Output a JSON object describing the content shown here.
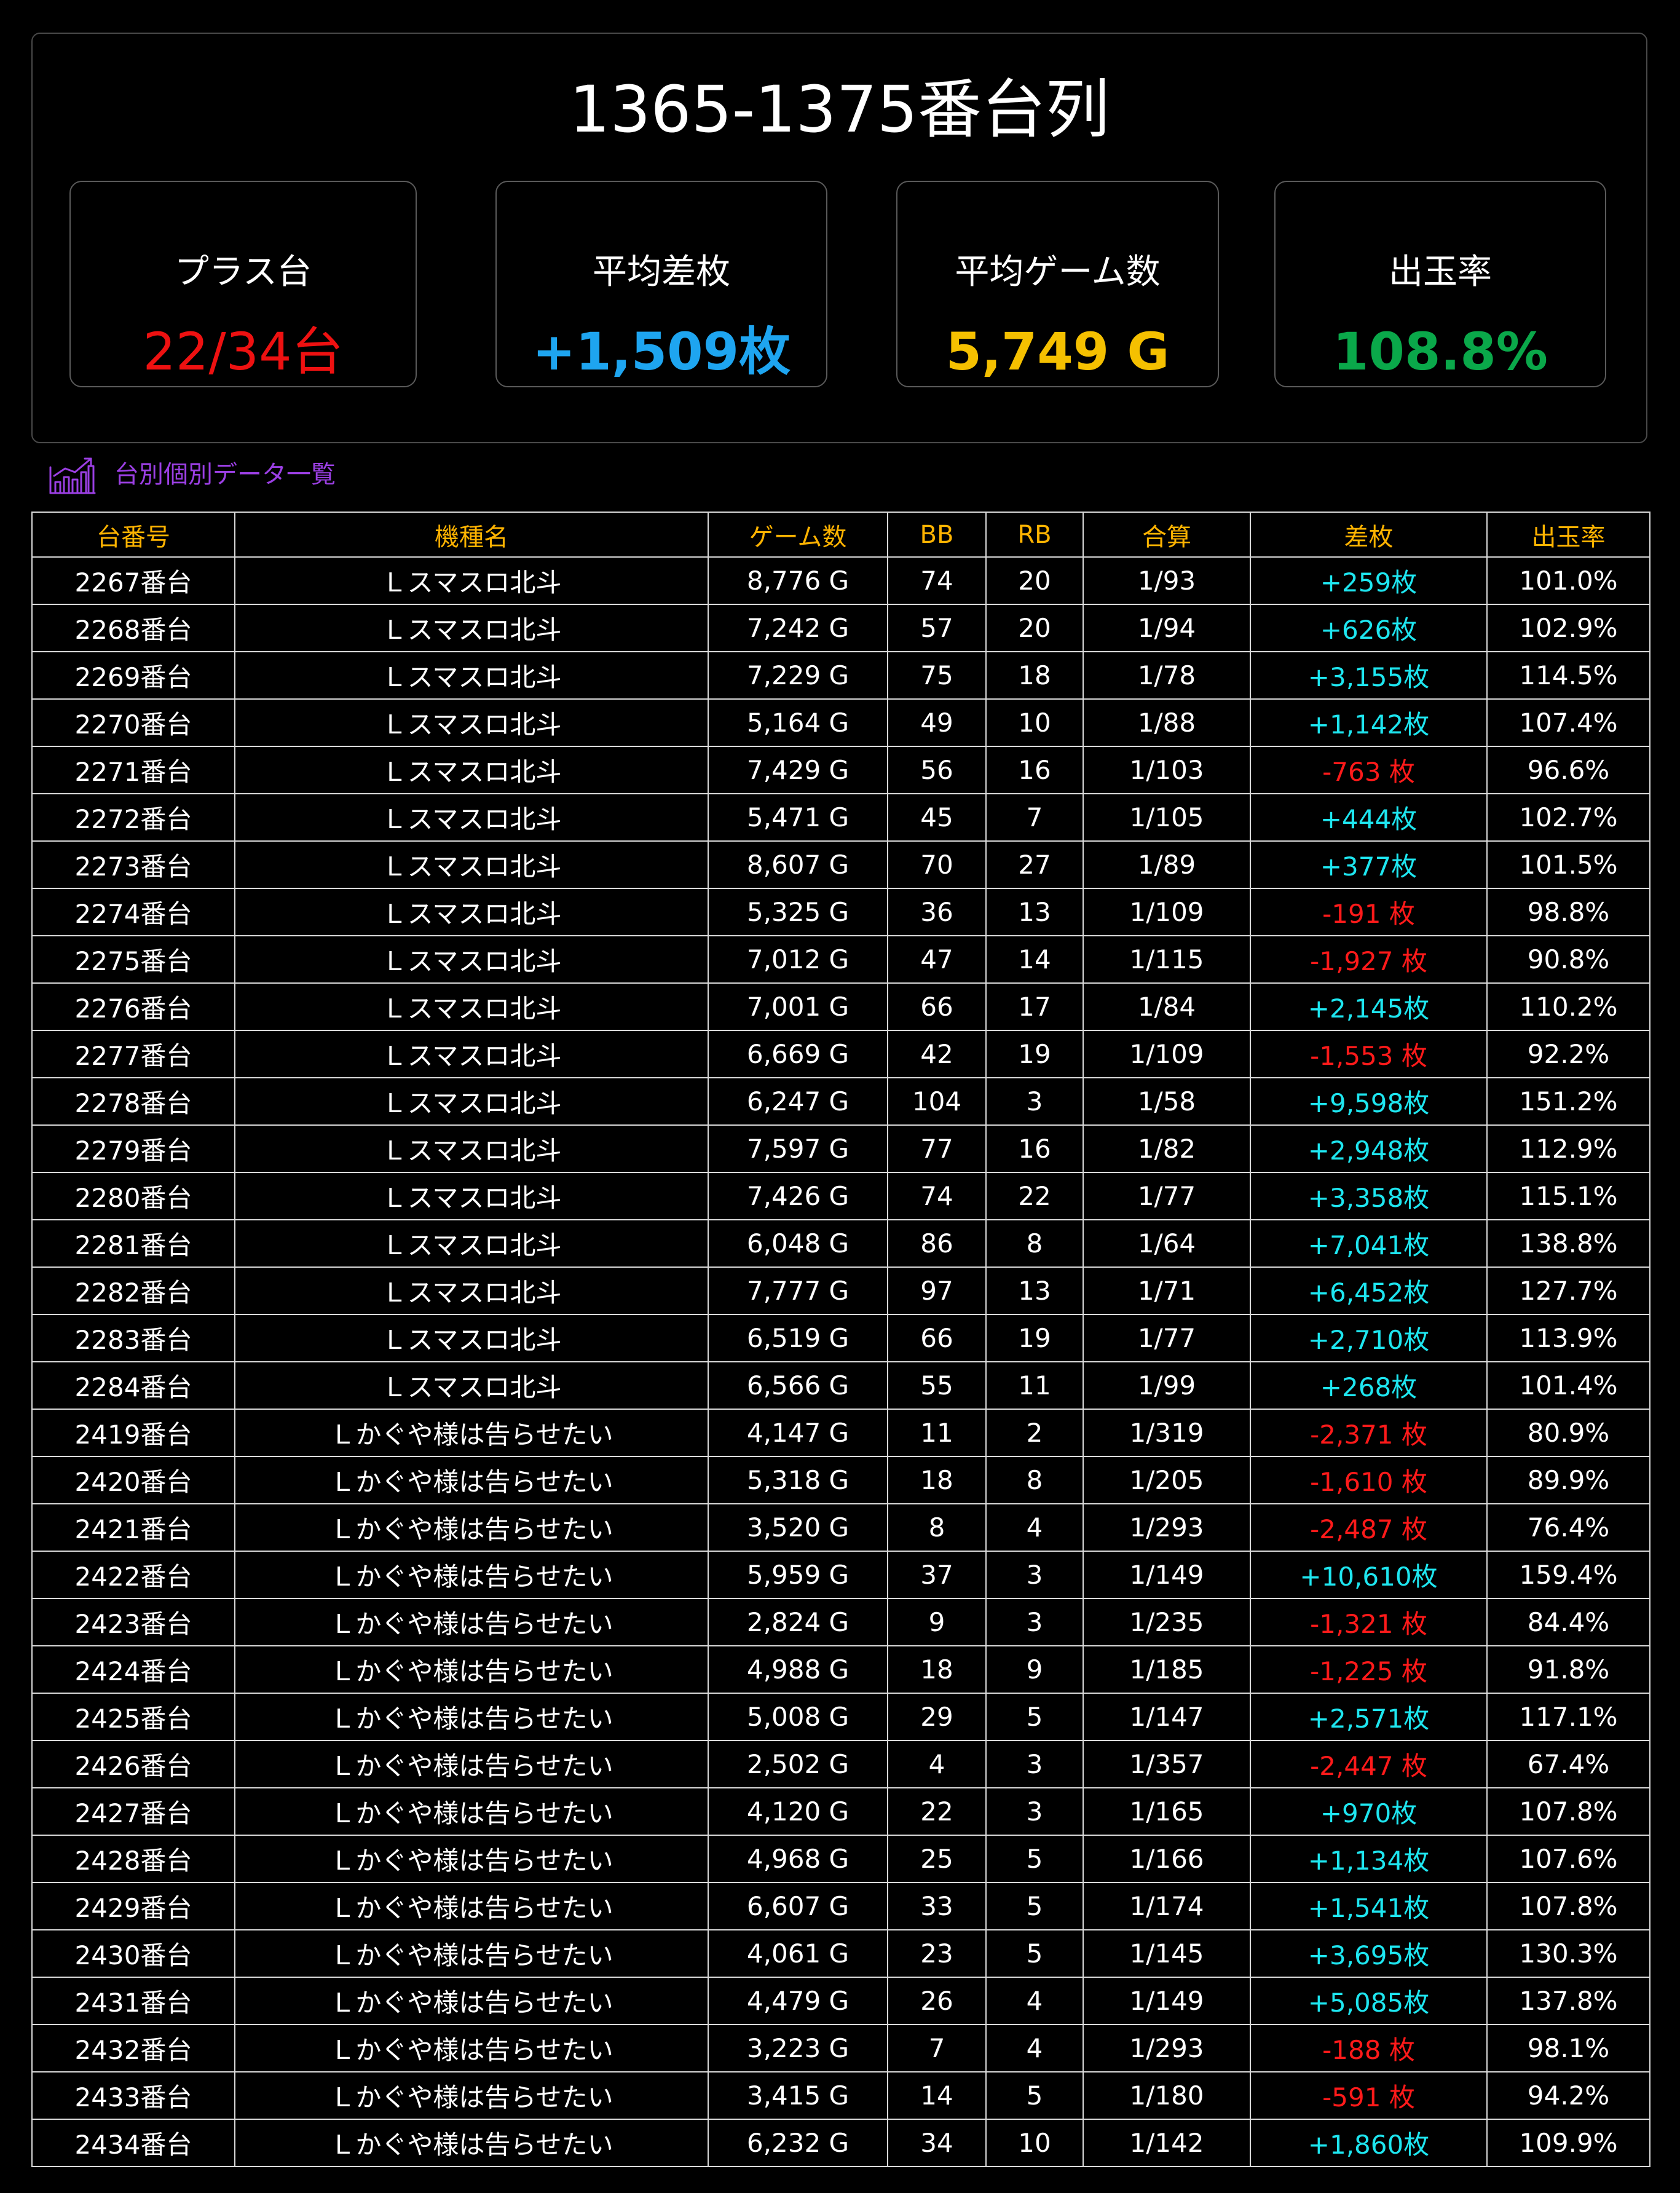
{
  "title": "1365-1375番台列",
  "stats": [
    {
      "label": "プラス台",
      "value": "22/34台",
      "color": "#ee1111"
    },
    {
      "label": "平均差枚",
      "value": "+1,509枚",
      "color": "#1ea5f0"
    },
    {
      "label": "平均ゲーム数",
      "value": "5,749 G",
      "color": "#f5c000"
    },
    {
      "label": "出玉率",
      "value": "108.8%",
      "color": "#0aa84a"
    }
  ],
  "section": {
    "title": "台別個別データ一覧",
    "icon": "bar-chart-trend-icon",
    "color": "#9b3fe3"
  },
  "table": {
    "header_color": "#ffb300",
    "columns": [
      "台番号",
      "機種名",
      "ゲーム数",
      "BB",
      "RB",
      "合算",
      "差枚",
      "出玉率"
    ],
    "rows": [
      [
        "2267番台",
        "Ｌスマスロ北斗",
        "8,776 G",
        "74",
        "20",
        "1/93",
        "+259枚",
        "101.0%"
      ],
      [
        "2268番台",
        "Ｌスマスロ北斗",
        "7,242 G",
        "57",
        "20",
        "1/94",
        "+626枚",
        "102.9%"
      ],
      [
        "2269番台",
        "Ｌスマスロ北斗",
        "7,229 G",
        "75",
        "18",
        "1/78",
        "+3,155枚",
        "114.5%"
      ],
      [
        "2270番台",
        "Ｌスマスロ北斗",
        "5,164 G",
        "49",
        "10",
        "1/88",
        "+1,142枚",
        "107.4%"
      ],
      [
        "2271番台",
        "Ｌスマスロ北斗",
        "7,429 G",
        "56",
        "16",
        "1/103",
        "-763 枚",
        "96.6%"
      ],
      [
        "2272番台",
        "Ｌスマスロ北斗",
        "5,471 G",
        "45",
        "7",
        "1/105",
        "+444枚",
        "102.7%"
      ],
      [
        "2273番台",
        "Ｌスマスロ北斗",
        "8,607 G",
        "70",
        "27",
        "1/89",
        "+377枚",
        "101.5%"
      ],
      [
        "2274番台",
        "Ｌスマスロ北斗",
        "5,325 G",
        "36",
        "13",
        "1/109",
        "-191 枚",
        "98.8%"
      ],
      [
        "2275番台",
        "Ｌスマスロ北斗",
        "7,012 G",
        "47",
        "14",
        "1/115",
        "-1,927 枚",
        "90.8%"
      ],
      [
        "2276番台",
        "Ｌスマスロ北斗",
        "7,001 G",
        "66",
        "17",
        "1/84",
        "+2,145枚",
        "110.2%"
      ],
      [
        "2277番台",
        "Ｌスマスロ北斗",
        "6,669 G",
        "42",
        "19",
        "1/109",
        "-1,553 枚",
        "92.2%"
      ],
      [
        "2278番台",
        "Ｌスマスロ北斗",
        "6,247 G",
        "104",
        "3",
        "1/58",
        "+9,598枚",
        "151.2%"
      ],
      [
        "2279番台",
        "Ｌスマスロ北斗",
        "7,597 G",
        "77",
        "16",
        "1/82",
        "+2,948枚",
        "112.9%"
      ],
      [
        "2280番台",
        "Ｌスマスロ北斗",
        "7,426 G",
        "74",
        "22",
        "1/77",
        "+3,358枚",
        "115.1%"
      ],
      [
        "2281番台",
        "Ｌスマスロ北斗",
        "6,048 G",
        "86",
        "8",
        "1/64",
        "+7,041枚",
        "138.8%"
      ],
      [
        "2282番台",
        "Ｌスマスロ北斗",
        "7,777 G",
        "97",
        "13",
        "1/71",
        "+6,452枚",
        "127.7%"
      ],
      [
        "2283番台",
        "Ｌスマスロ北斗",
        "6,519 G",
        "66",
        "19",
        "1/77",
        "+2,710枚",
        "113.9%"
      ],
      [
        "2284番台",
        "Ｌスマスロ北斗",
        "6,566 G",
        "55",
        "11",
        "1/99",
        "+268枚",
        "101.4%"
      ],
      [
        "2419番台",
        "Ｌかぐや様は告らせたい",
        "4,147 G",
        "11",
        "2",
        "1/319",
        "-2,371 枚",
        "80.9%"
      ],
      [
        "2420番台",
        "Ｌかぐや様は告らせたい",
        "5,318 G",
        "18",
        "8",
        "1/205",
        "-1,610 枚",
        "89.9%"
      ],
      [
        "2421番台",
        "Ｌかぐや様は告らせたい",
        "3,520 G",
        "8",
        "4",
        "1/293",
        "-2,487 枚",
        "76.4%"
      ],
      [
        "2422番台",
        "Ｌかぐや様は告らせたい",
        "5,959 G",
        "37",
        "3",
        "1/149",
        "+10,610枚",
        "159.4%"
      ],
      [
        "2423番台",
        "Ｌかぐや様は告らせたい",
        "2,824 G",
        "9",
        "3",
        "1/235",
        "-1,321 枚",
        "84.4%"
      ],
      [
        "2424番台",
        "Ｌかぐや様は告らせたい",
        "4,988 G",
        "18",
        "9",
        "1/185",
        "-1,225 枚",
        "91.8%"
      ],
      [
        "2425番台",
        "Ｌかぐや様は告らせたい",
        "5,008 G",
        "29",
        "5",
        "1/147",
        "+2,571枚",
        "117.1%"
      ],
      [
        "2426番台",
        "Ｌかぐや様は告らせたい",
        "2,502 G",
        "4",
        "3",
        "1/357",
        "-2,447 枚",
        "67.4%"
      ],
      [
        "2427番台",
        "Ｌかぐや様は告らせたい",
        "4,120 G",
        "22",
        "3",
        "1/165",
        "+970枚",
        "107.8%"
      ],
      [
        "2428番台",
        "Ｌかぐや様は告らせたい",
        "4,968 G",
        "25",
        "5",
        "1/166",
        "+1,134枚",
        "107.6%"
      ],
      [
        "2429番台",
        "Ｌかぐや様は告らせたい",
        "6,607 G",
        "33",
        "5",
        "1/174",
        "+1,541枚",
        "107.8%"
      ],
      [
        "2430番台",
        "Ｌかぐや様は告らせたい",
        "4,061 G",
        "23",
        "5",
        "1/145",
        "+3,695枚",
        "130.3%"
      ],
      [
        "2431番台",
        "Ｌかぐや様は告らせたい",
        "4,479 G",
        "26",
        "4",
        "1/149",
        "+5,085枚",
        "137.8%"
      ],
      [
        "2432番台",
        "Ｌかぐや様は告らせたい",
        "3,223 G",
        "7",
        "4",
        "1/293",
        "-188 枚",
        "98.1%"
      ],
      [
        "2433番台",
        "Ｌかぐや様は告らせたい",
        "3,415 G",
        "14",
        "5",
        "1/180",
        "-591 枚",
        "94.2%"
      ],
      [
        "2434番台",
        "Ｌかぐや様は告らせたい",
        "6,232 G",
        "34",
        "10",
        "1/142",
        "+1,860枚",
        "109.9%"
      ]
    ]
  }
}
